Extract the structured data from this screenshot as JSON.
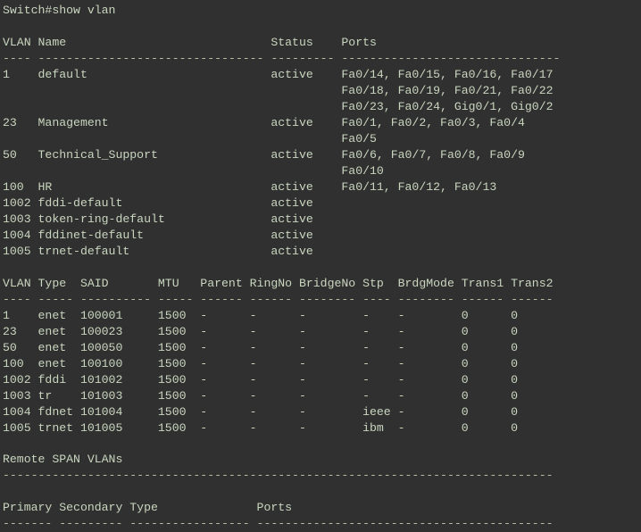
{
  "terminal": {
    "prompt": "Switch#show vlan",
    "vlan_header": "VLAN Name                             Status    Ports",
    "vlan_separator": "---- -------------------------------- --------- -------------------------------",
    "vlan_rows": [
      "1    default                          active    Fa0/14, Fa0/15, Fa0/16, Fa0/17",
      "                                                Fa0/18, Fa0/19, Fa0/21, Fa0/22",
      "                                                Fa0/23, Fa0/24, Gig0/1, Gig0/2",
      "23   Management                       active    Fa0/1, Fa0/2, Fa0/3, Fa0/4",
      "                                                Fa0/5",
      "50   Technical_Support                active    Fa0/6, Fa0/7, Fa0/8, Fa0/9",
      "                                                Fa0/10",
      "100  HR                               active    Fa0/11, Fa0/12, Fa0/13",
      "1002 fddi-default                     active",
      "1003 token-ring-default               active",
      "1004 fddinet-default                  active",
      "1005 trnet-default                    active"
    ],
    "type_header": "VLAN Type  SAID       MTU   Parent RingNo BridgeNo Stp  BrdgMode Trans1 Trans2",
    "type_separator": "---- ----- ---------- ----- ------ ------ -------- ---- -------- ------ ------",
    "type_rows": [
      "1    enet  100001     1500  -      -      -        -    -        0      0",
      "23   enet  100023     1500  -      -      -        -    -        0      0",
      "50   enet  100050     1500  -      -      -        -    -        0      0",
      "100  enet  100100     1500  -      -      -        -    -        0      0",
      "1002 fddi  101002     1500  -      -      -        -    -        0      0",
      "1003 tr    101003     1500  -      -      -        -    -        0      0",
      "1004 fdnet 101004     1500  -      -      -        ieee -        0      0",
      "1005 trnet 101005     1500  -      -      -        ibm  -        0      0"
    ],
    "remote_span_title": "Remote SPAN VLANs",
    "remote_span_separator": "------------------------------------------------------------------------------",
    "primary_header": "Primary Secondary Type              Ports",
    "primary_separator": "------- --------- ----------------- ------------------------------------------"
  }
}
